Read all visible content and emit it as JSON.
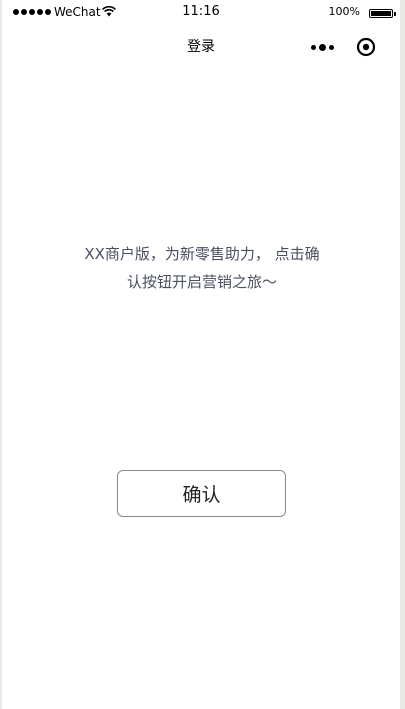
{
  "status_bar": {
    "carrier": "WeChat",
    "time": "11:16",
    "battery_percent": "100%"
  },
  "nav": {
    "title": "登录",
    "more_icon": "more-dots-icon",
    "close_icon": "target-close-icon"
  },
  "content": {
    "intro_line1": "XX商户版，为新零售助力， 点击确",
    "intro_line2": "认按钮开启营销之旅～",
    "confirm_label": "确认"
  },
  "colors": {
    "intro_text": "#4a5060",
    "button_border": "#8a8a8a",
    "background": "#ffffff"
  }
}
